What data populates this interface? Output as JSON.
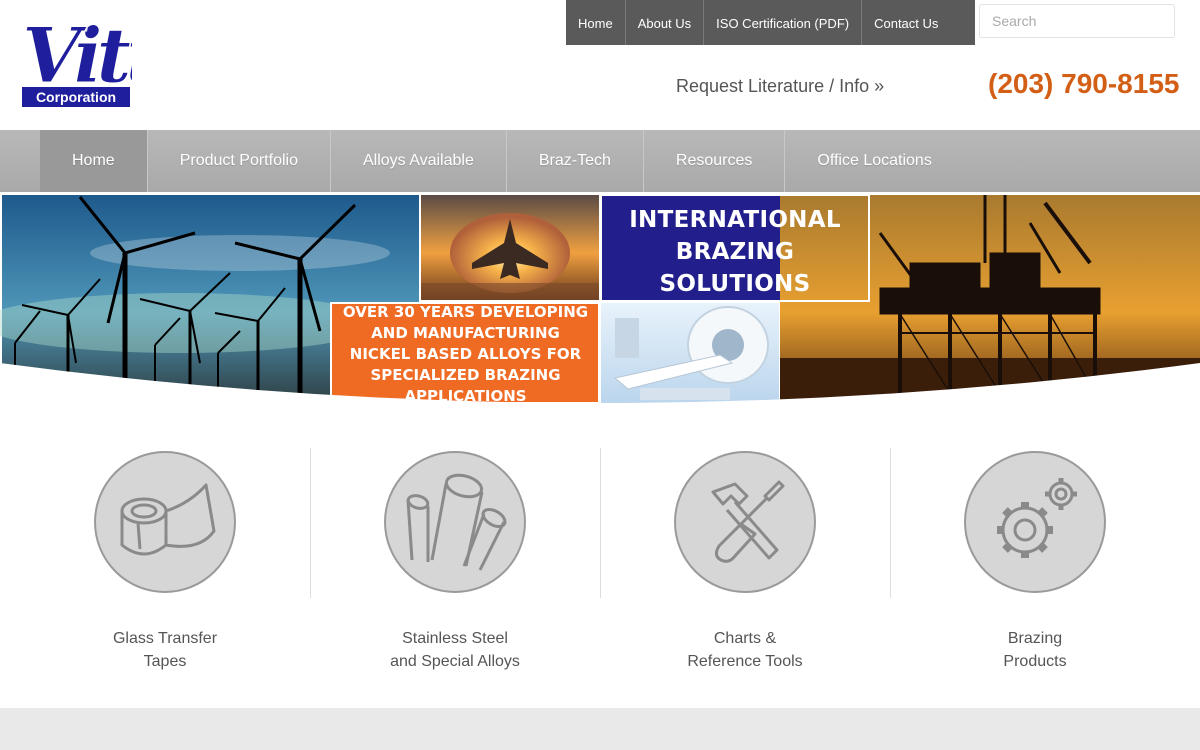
{
  "brand": {
    "logo_wordmark": "Vitta",
    "logo_subtitle": "Corporation"
  },
  "colors": {
    "brand_blue": "#1f1f9e",
    "accent_orange": "#d35f17",
    "topnav_bg": "#5a5a5a",
    "mainnav_bg": "#aaaaaa"
  },
  "topnav": {
    "items": [
      "Home",
      "About Us",
      "ISO Certification (PDF)",
      "Contact Us"
    ]
  },
  "search": {
    "placeholder": "Search"
  },
  "header": {
    "request_literature": "Request Literature / Info »",
    "phone": "(203) 790-8155"
  },
  "mainnav": {
    "items": [
      "Home",
      "Product Portfolio",
      "Alloys Available",
      "Braz-Tech",
      "Resources",
      "Office Locations"
    ],
    "active_index": 0
  },
  "hero": {
    "headline": "INTERNATIONAL BRAZING SOLUTIONS",
    "tagline": "OVER 30 YEARS DEVELOPING AND MANUFACTURING NICKEL BASED ALLOYS FOR SPECIALIZED BRAZING APPLICATIONS"
  },
  "features": [
    {
      "line1": "Glass Transfer",
      "line2": "Tapes",
      "icon": "tape-roll-icon"
    },
    {
      "line1": "Stainless Steel",
      "line2": "and Special Alloys",
      "icon": "alloy-rods-icon"
    },
    {
      "line1": "Charts &",
      "line2": "Reference Tools",
      "icon": "tools-icon"
    },
    {
      "line1": "Brazing",
      "line2": "Products",
      "icon": "gears-icon"
    }
  ]
}
